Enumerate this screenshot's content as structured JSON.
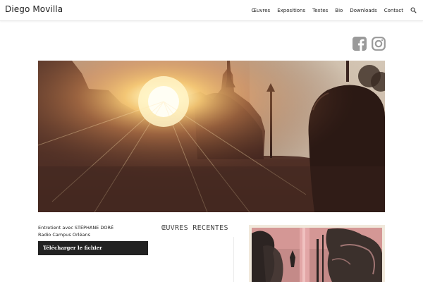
{
  "header": {
    "site_title": "Diego Movilla",
    "nav": [
      "Œuvres",
      "Expositions",
      "Textes",
      "Bio",
      "Downloads",
      "Contact"
    ],
    "search_icon": "search-icon"
  },
  "social": {
    "icons": [
      "facebook-icon",
      "instagram-icon"
    ],
    "color": "#9a9a9a"
  },
  "hero": {
    "subject": "sunset-silhouette-photo"
  },
  "left_column": {
    "interview_line1": "Entretient avec STÉPHANE DORÉ",
    "interview_line2": "Radio Campus Orléans",
    "download_label": "Télécharger le fichier"
  },
  "middle_column": {
    "heading": "ŒUVRES RECENTES"
  },
  "colors": {
    "button_bg": "#222222",
    "text": "#222222",
    "muted": "#9a9a9a"
  }
}
